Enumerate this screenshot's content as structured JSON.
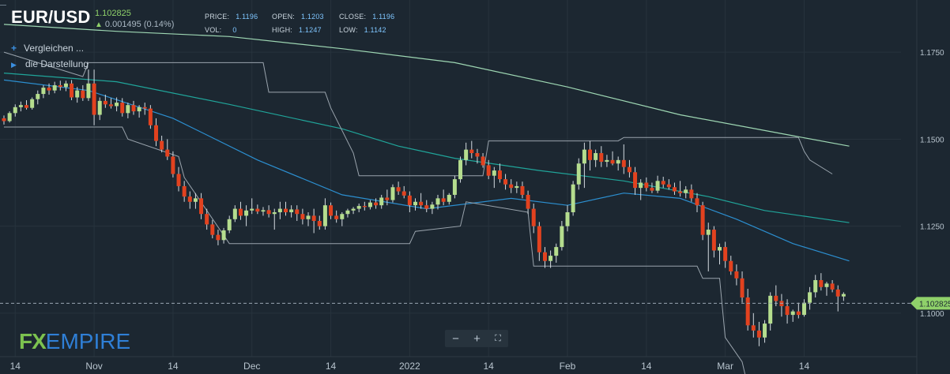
{
  "header": {
    "symbol": "EUR/USD",
    "price": "1.102825",
    "change": "0.001495 (0.14%)",
    "stats": [
      {
        "label": "PRICE:",
        "value": "1.1196"
      },
      {
        "label": "OPEN:",
        "value": "1.1203"
      },
      {
        "label": "CLOSE:",
        "value": "1.1196"
      },
      {
        "label": "VOL:",
        "value": "0"
      },
      {
        "label": "HIGH:",
        "value": "1.1247"
      },
      {
        "label": "LOW:",
        "value": "1.1142"
      }
    ]
  },
  "sidebar": {
    "compare_label": "Vergleichen ...",
    "display_label": "die Darstellung"
  },
  "zoom": {
    "minus": "−",
    "plus": "+",
    "fit": "⛶"
  },
  "logo": {
    "fx": "FX",
    "rest": "EMPIRE"
  },
  "colors": {
    "background": "#1c2731",
    "up": "#b5dd8e",
    "down": "#e2421f",
    "ma_long": "#9ed7b3",
    "ma_mid": "#20a59a",
    "ma_short": "#2c8fd0",
    "channel": "#9aa4ad",
    "price_tag": "#8fd16a"
  },
  "chart_data": {
    "type": "candlestick",
    "ylim": [
      1.0875,
      1.19
    ],
    "y_ticks": [
      "1.1750",
      "1.1500",
      "1.1250",
      "1.1000"
    ],
    "y_tick_values": [
      1.175,
      1.15,
      1.125,
      1.1
    ],
    "x_ticks": [
      "14",
      "Nov",
      "14",
      "Dec",
      "14",
      "2022",
      "14",
      "Feb",
      "14",
      "Mar",
      "14"
    ],
    "x_tick_index": [
      2,
      16,
      30,
      44,
      58,
      72,
      86,
      100,
      114,
      128,
      142
    ],
    "x_range": [
      0,
      150
    ],
    "current_price": 1.102825,
    "current_label": "1.102825",
    "candles": [
      [
        1.156,
        1.1568,
        1.1542,
        1.1552
      ],
      [
        1.1552,
        1.158,
        1.1548,
        1.1575
      ],
      [
        1.1575,
        1.16,
        1.1565,
        1.1592
      ],
      [
        1.1592,
        1.1608,
        1.158,
        1.1598
      ],
      [
        1.1598,
        1.1612,
        1.1585,
        1.159
      ],
      [
        1.159,
        1.162,
        1.1585,
        1.1615
      ],
      [
        1.1615,
        1.164,
        1.16,
        1.163
      ],
      [
        1.163,
        1.1655,
        1.1618,
        1.1648
      ],
      [
        1.1648,
        1.166,
        1.1628,
        1.164
      ],
      [
        1.164,
        1.1665,
        1.1632,
        1.1655
      ],
      [
        1.1655,
        1.1668,
        1.164,
        1.165
      ],
      [
        1.165,
        1.1668,
        1.1638,
        1.166
      ],
      [
        1.166,
        1.167,
        1.1612,
        1.162
      ],
      [
        1.162,
        1.165,
        1.1605,
        1.164
      ],
      [
        1.164,
        1.1655,
        1.161,
        1.1618
      ],
      [
        1.1618,
        1.17,
        1.161,
        1.166
      ],
      [
        1.166,
        1.17,
        1.154,
        1.157
      ],
      [
        1.157,
        1.162,
        1.1555,
        1.161
      ],
      [
        1.161,
        1.1628,
        1.159,
        1.16
      ],
      [
        1.16,
        1.1618,
        1.1588,
        1.1595
      ],
      [
        1.1595,
        1.162,
        1.158,
        1.1605
      ],
      [
        1.1605,
        1.1618,
        1.1565,
        1.1575
      ],
      [
        1.1575,
        1.1605,
        1.156,
        1.1598
      ],
      [
        1.1598,
        1.161,
        1.157,
        1.158
      ],
      [
        1.158,
        1.1598,
        1.1562,
        1.1592
      ],
      [
        1.1592,
        1.1605,
        1.157,
        1.1588
      ],
      [
        1.1588,
        1.1598,
        1.153,
        1.154
      ],
      [
        1.154,
        1.156,
        1.148,
        1.1495
      ],
      [
        1.1495,
        1.151,
        1.1462,
        1.147
      ],
      [
        1.147,
        1.15,
        1.144,
        1.145
      ],
      [
        1.145,
        1.1465,
        1.139,
        1.14
      ],
      [
        1.14,
        1.142,
        1.135,
        1.1365
      ],
      [
        1.1365,
        1.138,
        1.132,
        1.1335
      ],
      [
        1.1335,
        1.135,
        1.13,
        1.132
      ],
      [
        1.132,
        1.1345,
        1.13,
        1.133
      ],
      [
        1.133,
        1.1345,
        1.127,
        1.1285
      ],
      [
        1.1285,
        1.13,
        1.124,
        1.1255
      ],
      [
        1.1255,
        1.1268,
        1.1215,
        1.1225
      ],
      [
        1.1225,
        1.124,
        1.1195,
        1.121
      ],
      [
        1.121,
        1.1245,
        1.12,
        1.1238
      ],
      [
        1.1238,
        1.128,
        1.123,
        1.127
      ],
      [
        1.127,
        1.131,
        1.1262,
        1.13
      ],
      [
        1.13,
        1.132,
        1.1268,
        1.128
      ],
      [
        1.128,
        1.131,
        1.125,
        1.1295
      ],
      [
        1.1295,
        1.133,
        1.1285,
        1.13
      ],
      [
        1.13,
        1.1312,
        1.1285,
        1.1292
      ],
      [
        1.1292,
        1.1305,
        1.128,
        1.1296
      ],
      [
        1.1296,
        1.131,
        1.1275,
        1.1285
      ],
      [
        1.1285,
        1.13,
        1.124,
        1.129
      ],
      [
        1.129,
        1.132,
        1.127,
        1.13
      ],
      [
        1.13,
        1.132,
        1.128,
        1.129
      ],
      [
        1.129,
        1.131,
        1.1275,
        1.1298
      ],
      [
        1.1298,
        1.131,
        1.1265,
        1.1285
      ],
      [
        1.1285,
        1.13,
        1.1255,
        1.127
      ],
      [
        1.127,
        1.129,
        1.125,
        1.128
      ],
      [
        1.128,
        1.13,
        1.123,
        1.1265
      ],
      [
        1.1265,
        1.128,
        1.124,
        1.125
      ],
      [
        1.125,
        1.133,
        1.124,
        1.131
      ],
      [
        1.131,
        1.1318,
        1.127,
        1.128
      ],
      [
        1.128,
        1.1295,
        1.126,
        1.127
      ],
      [
        1.127,
        1.129,
        1.125,
        1.1285
      ],
      [
        1.1285,
        1.13,
        1.1275,
        1.1295
      ],
      [
        1.1295,
        1.1305,
        1.1285,
        1.13
      ],
      [
        1.13,
        1.1315,
        1.129,
        1.1308
      ],
      [
        1.1308,
        1.132,
        1.1295,
        1.1305
      ],
      [
        1.1305,
        1.1325,
        1.1298,
        1.1318
      ],
      [
        1.1318,
        1.133,
        1.13,
        1.131
      ],
      [
        1.131,
        1.134,
        1.13,
        1.1332
      ],
      [
        1.1332,
        1.1355,
        1.131,
        1.1325
      ],
      [
        1.1325,
        1.137,
        1.1318,
        1.1362
      ],
      [
        1.1362,
        1.1378,
        1.134,
        1.135
      ],
      [
        1.135,
        1.1365,
        1.133,
        1.1338
      ],
      [
        1.1338,
        1.135,
        1.129,
        1.131
      ],
      [
        1.131,
        1.133,
        1.1295,
        1.132
      ],
      [
        1.132,
        1.1345,
        1.13,
        1.131
      ],
      [
        1.131,
        1.1325,
        1.129,
        1.13
      ],
      [
        1.13,
        1.132,
        1.1285,
        1.1312
      ],
      [
        1.1312,
        1.134,
        1.1298,
        1.133
      ],
      [
        1.133,
        1.1355,
        1.131,
        1.132
      ],
      [
        1.132,
        1.1345,
        1.1312,
        1.134
      ],
      [
        1.134,
        1.1395,
        1.133,
        1.1385
      ],
      [
        1.1385,
        1.145,
        1.1375,
        1.144
      ],
      [
        1.144,
        1.149,
        1.1425,
        1.147
      ],
      [
        1.147,
        1.1495,
        1.1445,
        1.146
      ],
      [
        1.146,
        1.1472,
        1.143,
        1.145
      ],
      [
        1.145,
        1.146,
        1.1418,
        1.1425
      ],
      [
        1.1425,
        1.144,
        1.1385,
        1.1395
      ],
      [
        1.1395,
        1.142,
        1.136,
        1.141
      ],
      [
        1.141,
        1.143,
        1.1375,
        1.1385
      ],
      [
        1.1385,
        1.14,
        1.1355,
        1.137
      ],
      [
        1.137,
        1.1385,
        1.1345,
        1.136
      ],
      [
        1.136,
        1.1378,
        1.1345,
        1.1365
      ],
      [
        1.1365,
        1.1378,
        1.133,
        1.134
      ],
      [
        1.134,
        1.1352,
        1.1285,
        1.13
      ],
      [
        1.13,
        1.1315,
        1.123,
        1.125
      ],
      [
        1.125,
        1.1262,
        1.115,
        1.1175
      ],
      [
        1.1175,
        1.119,
        1.113,
        1.115
      ],
      [
        1.115,
        1.118,
        1.113,
        1.1165
      ],
      [
        1.1165,
        1.12,
        1.1145,
        1.119
      ],
      [
        1.119,
        1.1265,
        1.118,
        1.125
      ],
      [
        1.125,
        1.131,
        1.1235,
        1.129
      ],
      [
        1.129,
        1.138,
        1.128,
        1.137
      ],
      [
        1.137,
        1.1445,
        1.1355,
        1.143
      ],
      [
        1.143,
        1.149,
        1.136,
        1.147
      ],
      [
        1.147,
        1.1495,
        1.141,
        1.144
      ],
      [
        1.144,
        1.147,
        1.142,
        1.146
      ],
      [
        1.146,
        1.148,
        1.142,
        1.1435
      ],
      [
        1.1435,
        1.1455,
        1.142,
        1.144
      ],
      [
        1.144,
        1.1465,
        1.1425,
        1.143
      ],
      [
        1.143,
        1.145,
        1.141,
        1.144
      ],
      [
        1.144,
        1.1485,
        1.14,
        1.142
      ],
      [
        1.142,
        1.144,
        1.139,
        1.1405
      ],
      [
        1.1405,
        1.142,
        1.134,
        1.136
      ],
      [
        1.136,
        1.1385,
        1.1325,
        1.1375
      ],
      [
        1.1375,
        1.139,
        1.135,
        1.136
      ],
      [
        1.136,
        1.1375,
        1.1345,
        1.1352
      ],
      [
        1.1352,
        1.1395,
        1.1345,
        1.138
      ],
      [
        1.138,
        1.1392,
        1.136,
        1.137
      ],
      [
        1.137,
        1.1385,
        1.1355,
        1.1362
      ],
      [
        1.1362,
        1.1375,
        1.134,
        1.135
      ],
      [
        1.135,
        1.138,
        1.1335,
        1.1345
      ],
      [
        1.1345,
        1.1365,
        1.133,
        1.1355
      ],
      [
        1.1355,
        1.137,
        1.132,
        1.133
      ],
      [
        1.133,
        1.1345,
        1.129,
        1.131
      ],
      [
        1.131,
        1.132,
        1.121,
        1.1225
      ],
      [
        1.1225,
        1.126,
        1.112,
        1.124
      ],
      [
        1.124,
        1.125,
        1.116,
        1.118
      ],
      [
        1.118,
        1.12,
        1.114,
        1.119
      ],
      [
        1.119,
        1.1205,
        1.113,
        1.115
      ],
      [
        1.115,
        1.1165,
        1.111,
        1.112
      ],
      [
        1.112,
        1.114,
        1.108,
        1.11
      ],
      [
        1.11,
        1.112,
        1.103,
        1.1045
      ],
      [
        1.1045,
        1.107,
        1.095,
        1.0965
      ],
      [
        1.0965,
        1.1,
        1.093,
        1.095
      ],
      [
        1.095,
        1.0975,
        1.0905,
        1.093
      ],
      [
        1.093,
        1.098,
        1.0915,
        1.097
      ],
      [
        1.097,
        1.106,
        1.095,
        1.105
      ],
      [
        1.105,
        1.108,
        1.102,
        1.1035
      ],
      [
        1.1035,
        1.1055,
        1.099,
        1.102
      ],
      [
        1.102,
        1.104,
        1.097,
        1.0995
      ],
      [
        1.0995,
        1.101,
        1.0975,
        1.1005
      ],
      [
        1.1005,
        1.103,
        1.0985,
        1.0995
      ],
      [
        1.0995,
        1.104,
        1.099,
        1.103
      ],
      [
        1.103,
        1.1075,
        1.101,
        1.106
      ],
      [
        1.106,
        1.111,
        1.1045,
        1.1095
      ],
      [
        1.1095,
        1.1115,
        1.1065,
        1.1075
      ],
      [
        1.1075,
        1.109,
        1.105,
        1.1085
      ],
      [
        1.1085,
        1.1095,
        1.106,
        1.1068
      ],
      [
        1.1068,
        1.108,
        1.1005,
        1.1048
      ],
      [
        1.1048,
        1.106,
        1.1035,
        1.1055
      ]
    ],
    "ma_long": [
      [
        0,
        1.183
      ],
      [
        20,
        1.181
      ],
      [
        40,
        1.1795
      ],
      [
        60,
        1.176
      ],
      [
        80,
        1.172
      ],
      [
        100,
        1.165
      ],
      [
        120,
        1.157
      ],
      [
        140,
        1.151
      ],
      [
        150,
        1.148
      ]
    ],
    "ma_mid": [
      [
        0,
        1.169
      ],
      [
        20,
        1.1665
      ],
      [
        40,
        1.16
      ],
      [
        60,
        1.153
      ],
      [
        70,
        1.148
      ],
      [
        80,
        1.1445
      ],
      [
        95,
        1.141
      ],
      [
        110,
        1.138
      ],
      [
        125,
        1.1335
      ],
      [
        135,
        1.1295
      ],
      [
        150,
        1.126
      ]
    ],
    "ma_short": [
      [
        0,
        1.167
      ],
      [
        15,
        1.164
      ],
      [
        30,
        1.156
      ],
      [
        45,
        1.144
      ],
      [
        60,
        1.134
      ],
      [
        75,
        1.13
      ],
      [
        90,
        1.133
      ],
      [
        100,
        1.131
      ],
      [
        110,
        1.1345
      ],
      [
        120,
        1.133
      ],
      [
        130,
        1.127
      ],
      [
        140,
        1.12
      ],
      [
        150,
        1.115
      ]
    ],
    "channel_upper": [
      [
        0,
        1.175
      ],
      [
        14,
        1.168
      ],
      [
        15,
        1.172
      ],
      [
        46,
        1.172
      ],
      [
        47,
        1.1635
      ],
      [
        57,
        1.1635
      ],
      [
        58,
        1.159
      ],
      [
        62,
        1.146
      ],
      [
        63,
        1.1395
      ],
      [
        85,
        1.1395
      ],
      [
        86,
        1.1495
      ],
      [
        109,
        1.1495
      ],
      [
        110,
        1.1505
      ],
      [
        141,
        1.1505
      ],
      [
        142,
        1.1465
      ],
      [
        143,
        1.144
      ],
      [
        147,
        1.14
      ]
    ],
    "channel_lower": [
      [
        0,
        1.1535
      ],
      [
        21,
        1.1535
      ],
      [
        22,
        1.15
      ],
      [
        31,
        1.145
      ],
      [
        32,
        1.139
      ],
      [
        40,
        1.12
      ],
      [
        72,
        1.12
      ],
      [
        73,
        1.1235
      ],
      [
        81,
        1.125
      ],
      [
        82,
        1.132
      ],
      [
        93,
        1.129
      ],
      [
        94,
        1.1135
      ],
      [
        123,
        1.1135
      ],
      [
        124,
        1.11
      ],
      [
        127,
        1.11
      ],
      [
        128,
        1.093
      ],
      [
        131,
        1.086
      ],
      [
        132,
        1.079
      ],
      [
        147,
        1.079
      ]
    ]
  }
}
